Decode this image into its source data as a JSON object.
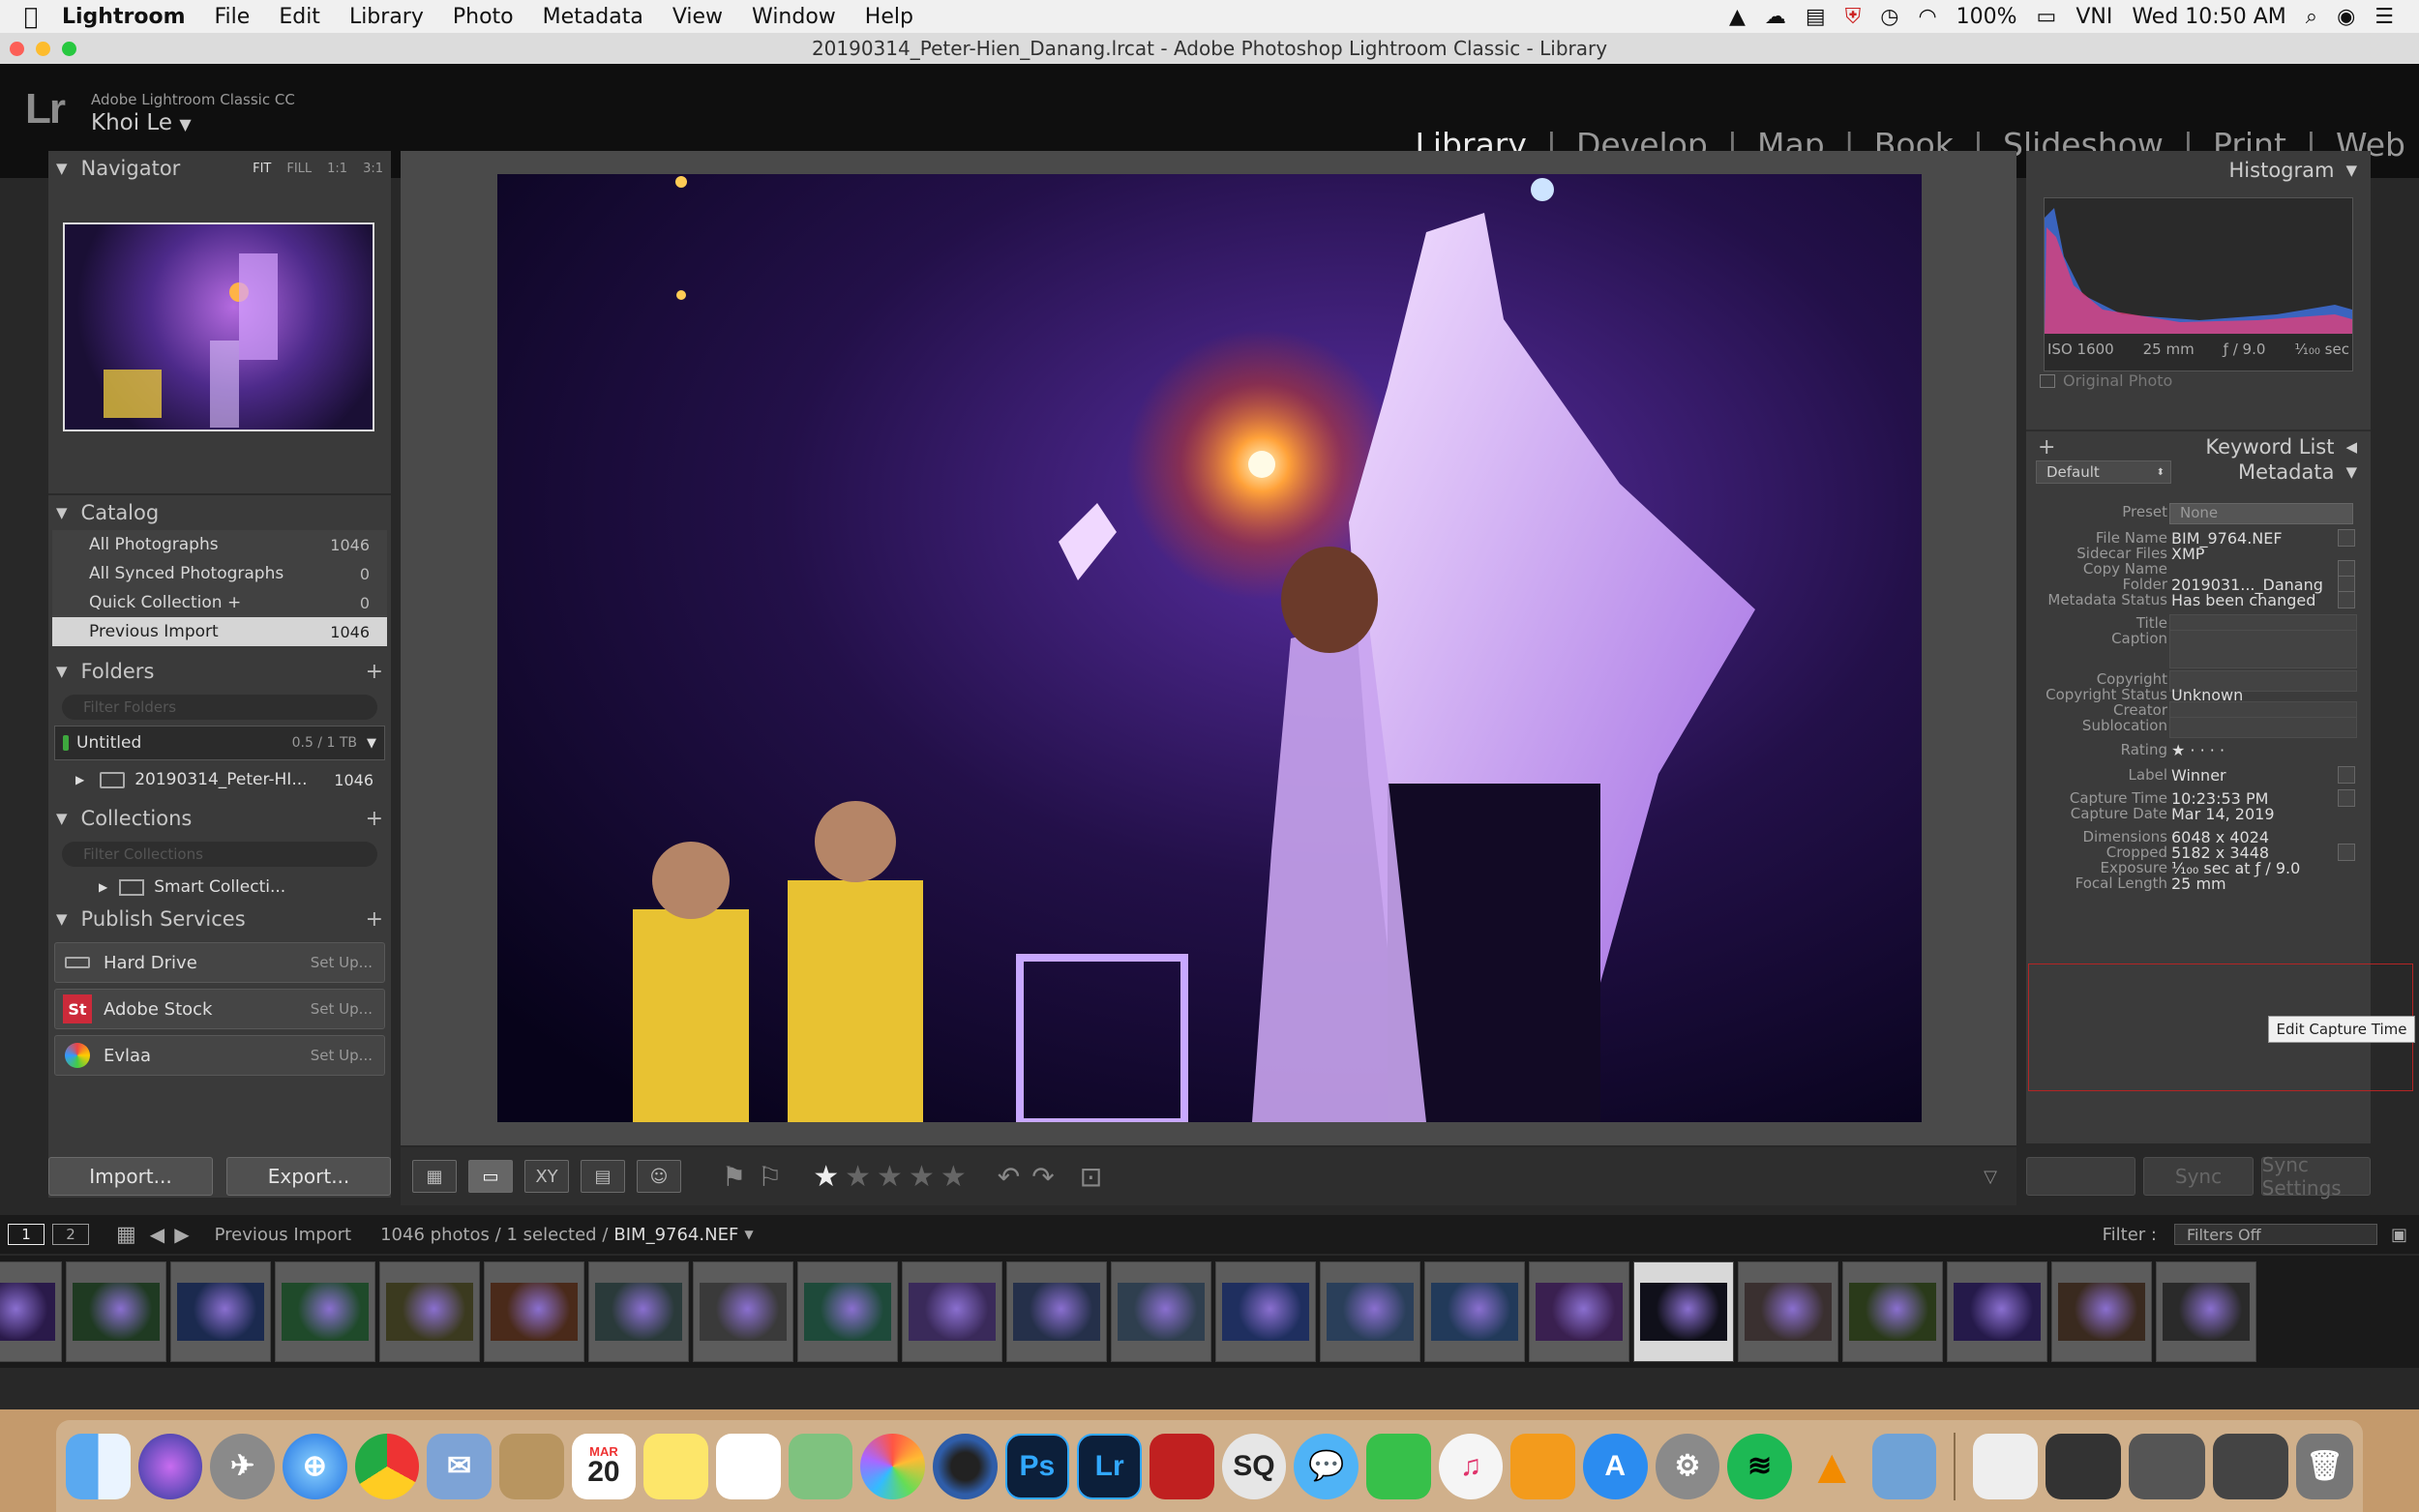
{
  "menubar": {
    "app": "Lightroom",
    "items": [
      "File",
      "Edit",
      "Library",
      "Photo",
      "Metadata",
      "View",
      "Window",
      "Help"
    ],
    "battery": "100%",
    "input": "VNI",
    "clock": "Wed 10:50 AM"
  },
  "window": {
    "title": "20190314_Peter-Hien_Danang.lrcat - Adobe Photoshop Lightroom Classic - Library"
  },
  "lr_header": {
    "logo": "Lr",
    "product": "Adobe Lightroom Classic CC",
    "user": "Khoi Le",
    "modules": [
      "Library",
      "Develop",
      "Map",
      "Book",
      "Slideshow",
      "Print",
      "Web"
    ],
    "active_module": "Library"
  },
  "navigator": {
    "title": "Navigator",
    "zoom": [
      "FIT",
      "FILL",
      "1:1",
      "3:1"
    ]
  },
  "catalog": {
    "title": "Catalog",
    "rows": [
      {
        "label": "All Photographs",
        "count": "1046"
      },
      {
        "label": "All Synced Photographs",
        "count": "0"
      },
      {
        "label": "Quick Collection +",
        "count": "0"
      },
      {
        "label": "Previous Import",
        "count": "1046"
      }
    ]
  },
  "folders": {
    "title": "Folders",
    "filter_placeholder": "Filter Folders",
    "volume": {
      "name": "Untitled",
      "capacity": "0.5 / 1 TB"
    },
    "folder": {
      "name": "20190314_Peter-HI...",
      "count": "1046"
    }
  },
  "collections": {
    "title": "Collections",
    "filter_placeholder": "Filter Collections",
    "smart": "Smart Collecti..."
  },
  "publish": {
    "title": "Publish Services",
    "services": [
      {
        "name": "Hard Drive",
        "action": "Set Up..."
      },
      {
        "name": "Adobe Stock",
        "action": "Set Up..."
      },
      {
        "name": "Evlaa",
        "action": "Set Up..."
      }
    ]
  },
  "left_buttons": {
    "import": "Import...",
    "export": "Export..."
  },
  "right_panel": {
    "histogram_title": "Histogram",
    "hist_info": {
      "iso": "ISO 1600",
      "focal": "25 mm",
      "aperture": "ƒ / 9.0",
      "shutter": "¹⁄₁₀₀ sec"
    },
    "original_photo": "Original Photo",
    "keyword_list": "Keyword List",
    "metadata_title": "Metadata",
    "metadata_preset_select": "Default",
    "preset_label": "Preset",
    "preset_value": "None",
    "metadata": [
      {
        "label": "File Name",
        "value": "BIM_9764.NEF"
      },
      {
        "label": "Sidecar Files",
        "value": "XMP"
      },
      {
        "label": "Copy Name",
        "value": ""
      },
      {
        "label": "Folder",
        "value": "2019031..._Danang"
      },
      {
        "label": "Metadata Status",
        "value": "Has been changed"
      },
      {
        "label": "Title",
        "value": ""
      },
      {
        "label": "Caption",
        "value": ""
      },
      {
        "label": "Copyright",
        "value": ""
      },
      {
        "label": "Copyright Status",
        "value": "Unknown"
      },
      {
        "label": "Creator",
        "value": ""
      },
      {
        "label": "Sublocation",
        "value": ""
      },
      {
        "label": "Rating",
        "value": "★ · · · ·"
      },
      {
        "label": "Label",
        "value": "Winner"
      },
      {
        "label": "Capture Time",
        "value": "10:23:53 PM"
      },
      {
        "label": "Capture Date",
        "value": "Mar 14, 2019"
      },
      {
        "label": "Dimensions",
        "value": "6048 x 4024"
      },
      {
        "label": "Cropped",
        "value": "5182 x 3448"
      },
      {
        "label": "Exposure",
        "value": "¹⁄₁₀₀ sec at ƒ / 9.0"
      },
      {
        "label": "Focal Length",
        "value": "25 mm"
      }
    ],
    "tooltip": "Edit Capture Time",
    "sync": "Sync",
    "sync_settings": "Sync Settings"
  },
  "filmbar": {
    "screens": [
      "1",
      "2"
    ],
    "source": "Previous Import",
    "status_prefix": "1046 photos / 1 selected /",
    "selected_file": "BIM_9764.NEF",
    "filter_label": "Filter :",
    "filter_value": "Filters Off"
  },
  "dock": {
    "apps": [
      "Finder",
      "Siri",
      "Launchpad",
      "Safari",
      "Chrome",
      "Mail",
      "Notes",
      "Calendar",
      "Stickies",
      "Reminders",
      "Maps",
      "Photos",
      "Aperture",
      "Photoshop",
      "Lightroom",
      "PDF",
      "SQ",
      "Messages",
      "FaceTime",
      "iTunes",
      "Books",
      "App Store",
      "Preferences",
      "Spotify",
      "VLC",
      "Preview"
    ],
    "calendar_month": "MAR",
    "calendar_day": "20",
    "ps": "Ps",
    "lr": "Lr",
    "sq": "SQ"
  }
}
